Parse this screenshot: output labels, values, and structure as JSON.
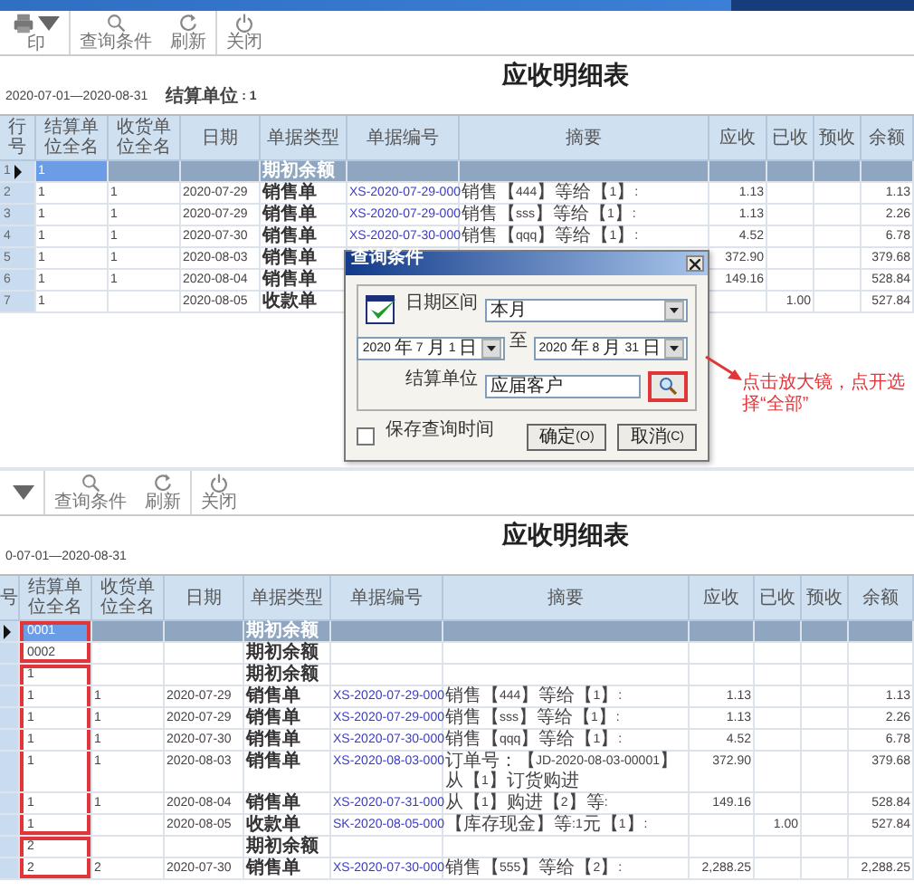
{
  "panels": [
    {
      "toolbar": [
        {
          "kind": "print",
          "label": "印"
        },
        {
          "kind": "search",
          "label": "查询条件"
        },
        {
          "kind": "refresh",
          "label": "刷新"
        },
        {
          "kind": "close",
          "label": "关闭"
        }
      ],
      "title": "应收明细表",
      "date_range": "2020-07-01—2020-08-31",
      "filter": "结算单位 : 1",
      "columns": [
        "行号",
        "结算单位全名",
        "收货单位全名",
        "日期",
        "单据类型",
        "单据编号",
        "摘要",
        "应收",
        "已收",
        "预收",
        "余额"
      ],
      "rows": [
        {
          "selected": true,
          "row_no": "1",
          "settlement_unit": "1",
          "doc_type": "期初余额"
        },
        {
          "selected": false,
          "row_no": "2",
          "settlement_unit": "1",
          "receiving_unit": "1",
          "date": "2020-07-29",
          "doc_type": "销售单",
          "doc_no": "XS-2020-07-29-000",
          "summary": "销售【444】等给【1】:",
          "receivable": "1.13",
          "balance": "1.13"
        },
        {
          "selected": false,
          "row_no": "3",
          "settlement_unit": "1",
          "receiving_unit": "1",
          "date": "2020-07-29",
          "doc_type": "销售单",
          "doc_no": "XS-2020-07-29-000",
          "summary": "销售【sss】等给【1】:",
          "receivable": "1.13",
          "balance": "2.26"
        },
        {
          "selected": false,
          "row_no": "4",
          "settlement_unit": "1",
          "receiving_unit": "1",
          "date": "2020-07-30",
          "doc_type": "销售单",
          "doc_no": "XS-2020-07-30-000",
          "summary": "销售【qqq】等给【1】:",
          "receivable": "4.52",
          "balance": "6.78"
        },
        {
          "selected": false,
          "row_no": "5",
          "settlement_unit": "1",
          "receiving_unit": "1",
          "date": "2020-08-03",
          "doc_type": "销售单",
          "receivable": "372.90",
          "balance": "379.68"
        },
        {
          "selected": false,
          "row_no": "6",
          "settlement_unit": "1",
          "receiving_unit": "1",
          "date": "2020-08-04",
          "doc_type": "销售单",
          "receivable": "149.16",
          "balance": "528.84"
        },
        {
          "selected": false,
          "row_no": "7",
          "settlement_unit": "1",
          "date": "2020-08-05",
          "doc_type": "收款单",
          "received": "1.00",
          "balance": "527.84"
        }
      ],
      "dialog": {
        "title": "查询条件",
        "date_label": "日期区间",
        "period": "本月",
        "date_from": "2020年 7月 1日",
        "date_sep": "至",
        "date_to": "2020年 8月31日",
        "unit_label": "结算单位",
        "unit_value": "应届客户",
        "lookup_outlined": true,
        "save_label": "保存查询时间",
        "save_checked": false,
        "buttons": [
          "确定(O)",
          "取消(C)"
        ]
      },
      "annotation": "点击放大镜，点开选择“全部”"
    },
    {
      "toolbar": [
        {
          "kind": "dropdown"
        },
        {
          "kind": "search",
          "label": "查询条件"
        },
        {
          "kind": "refresh",
          "label": "刷新"
        },
        {
          "kind": "close",
          "label": "关闭"
        }
      ],
      "title": "应收明细表",
      "date_range": "0-07-01—2020-08-31",
      "columns": [
        "号",
        "结算单位全名",
        "收货单位全名",
        "日期",
        "单据类型",
        "单据编号",
        "摘要",
        "应收",
        "已收",
        "预收",
        "余额"
      ],
      "rows": [
        {
          "selected": true,
          "outlined": true,
          "outline_start": true,
          "settlement_unit": "0001",
          "doc_type": "期初余额"
        },
        {
          "selected": false,
          "outlined": true,
          "outline_start": false,
          "settlement_unit": "0002",
          "doc_type": "期初余额"
        },
        {
          "selected": false,
          "outlined": true,
          "outline_start": true,
          "settlement_unit": "1",
          "doc_type": "期初余额"
        },
        {
          "selected": false,
          "outlined": true,
          "outline_start": false,
          "settlement_unit": "1",
          "receiving_unit": "1",
          "date": "2020-07-29",
          "doc_type": "销售单",
          "doc_no": "XS-2020-07-29-000",
          "summary": "销售【444】等给【1】:",
          "receivable": "1.13",
          "balance": "1.13"
        },
        {
          "selected": false,
          "outlined": true,
          "outline_start": false,
          "settlement_unit": "1",
          "receiving_unit": "1",
          "date": "2020-07-29",
          "doc_type": "销售单",
          "doc_no": "XS-2020-07-29-000",
          "summary": "销售【sss】等给【1】:",
          "receivable": "1.13",
          "balance": "2.26"
        },
        {
          "selected": false,
          "outlined": true,
          "outline_start": false,
          "settlement_unit": "1",
          "receiving_unit": "1",
          "date": "2020-07-30",
          "doc_type": "销售单",
          "doc_no": "XS-2020-07-30-000",
          "summary": "销售【qqq】等给【1】:",
          "receivable": "4.52",
          "balance": "6.78"
        },
        {
          "selected": false,
          "outlined": true,
          "outline_start": false,
          "settlement_unit": "1",
          "receiving_unit": "1",
          "date": "2020-08-03",
          "doc_type": "销售单",
          "doc_no": "XS-2020-08-03-000",
          "summary": "订单号：【JD-2020-08-03-00001】从【1】订货购进",
          "receivable": "372.90",
          "balance": "379.68"
        },
        {
          "selected": false,
          "outlined": true,
          "outline_start": false,
          "settlement_unit": "1",
          "receiving_unit": "1",
          "date": "2020-08-04",
          "doc_type": "销售单",
          "doc_no": "XS-2020-07-31-000",
          "summary": "从【1】购进【2】等:",
          "receivable": "149.16",
          "balance": "528.84"
        },
        {
          "selected": false,
          "outlined": true,
          "outline_start": false,
          "settlement_unit": "1",
          "date": "2020-08-05",
          "doc_type": "收款单",
          "doc_no": "SK-2020-08-05-000",
          "summary": "【库存现金】等:1元【1】:",
          "received": "1.00",
          "balance": "527.84"
        },
        {
          "selected": false,
          "outlined": true,
          "outline_start": true,
          "settlement_unit": "2",
          "doc_type": "期初余额"
        },
        {
          "selected": false,
          "outlined": true,
          "outline_start": false,
          "settlement_unit": "2",
          "receiving_unit": "2",
          "date": "2020-07-30",
          "doc_type": "销售单",
          "doc_no": "XS-2020-07-30-000",
          "summary": "销售【555】等给【2】:",
          "receivable": "2,288.25",
          "balance": "2,288.25"
        }
      ]
    }
  ]
}
